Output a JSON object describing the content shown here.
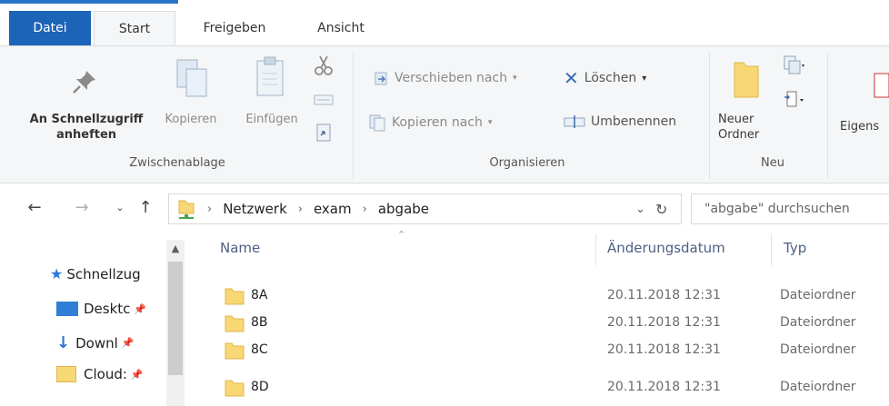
{
  "ribbon_tabs": {
    "file": "Datei",
    "start": "Start",
    "share": "Freigeben",
    "view": "Ansicht"
  },
  "clipboard": {
    "pin_line1": "An Schnellzugriff",
    "pin_line2": "anheften",
    "copy": "Kopieren",
    "paste": "Einfügen",
    "group": "Zwischenablage"
  },
  "organize": {
    "move_to": "Verschieben nach",
    "copy_to": "Kopieren nach",
    "delete": "Löschen",
    "rename": "Umbenennen",
    "group": "Organisieren"
  },
  "new": {
    "folder_line1": "Neuer",
    "folder_line2": "Ordner",
    "group": "Neu"
  },
  "open": {
    "properties": "Eigens"
  },
  "address": {
    "crumbs": [
      "Netzwerk",
      "exam",
      "abgabe"
    ],
    "search_placeholder": "\"abgabe\" durchsuchen"
  },
  "nav_pane": {
    "items": [
      {
        "label": "Schnellzug"
      },
      {
        "label": "Desktc"
      },
      {
        "label": "Downl"
      },
      {
        "label": "Cloud:"
      }
    ]
  },
  "file_list": {
    "columns": {
      "name": "Name",
      "date": "Änderungsdatum",
      "type": "Typ"
    },
    "rows": [
      {
        "name": "8A",
        "date": "20.11.2018 12:31",
        "type": "Dateiordner"
      },
      {
        "name": "8B",
        "date": "20.11.2018 12:31",
        "type": "Dateiordner"
      },
      {
        "name": "8C",
        "date": "20.11.2018 12:31",
        "type": "Dateiordner"
      },
      {
        "name": "8D",
        "date": "20.11.2018 12:31",
        "type": "Dateiordner"
      }
    ]
  },
  "colors": {
    "accent": "#1c64b7",
    "folder": "#f8d775",
    "header_text": "#4d6082"
  }
}
